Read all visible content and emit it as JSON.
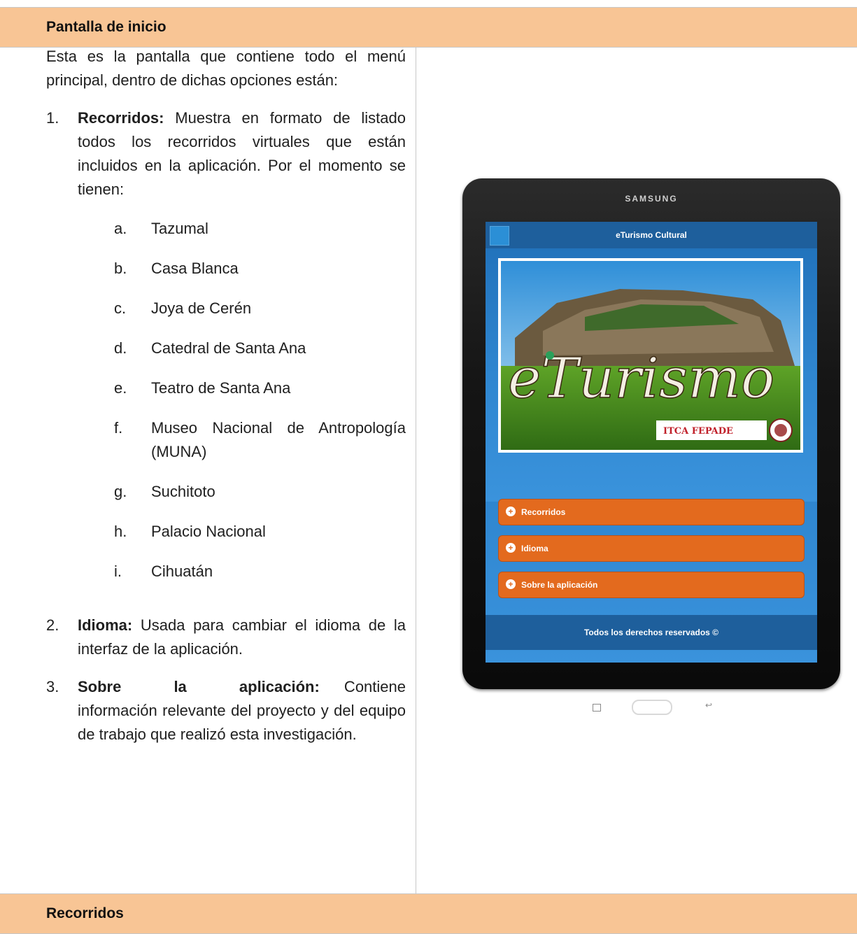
{
  "section_title": "Pantalla de inicio",
  "next_section_title": "Recorridos",
  "intro": "Esta es la pantalla que contiene todo el menú principal, dentro de dichas opciones están:",
  "items": [
    {
      "num": "1.",
      "bold": "Recorridos:",
      "text": " Muestra en formato de listado todos los recorridos virtuales que están incluidos en la aplicación. Por el momento se tienen:",
      "sub": [
        {
          "let": "a.",
          "text": "Tazumal"
        },
        {
          "let": "b.",
          "text": "Casa Blanca"
        },
        {
          "let": "c.",
          "text": "Joya de Cerén"
        },
        {
          "let": "d.",
          "text": "Catedral de Santa Ana"
        },
        {
          "let": "e.",
          "text": "Teatro de Santa Ana"
        },
        {
          "let": "f.",
          "text": "Museo Nacional de Antropología (MUNA)"
        },
        {
          "let": "g.",
          "text": "Suchitoto"
        },
        {
          "let": "h.",
          "text": "Palacio Nacional"
        },
        {
          "let": "i.",
          "text": "Cihuatán"
        }
      ]
    },
    {
      "num": "2.",
      "bold": "Idioma:",
      "text": " Usada para cambiar el idioma de la interfaz de la aplicación."
    },
    {
      "num": "3.",
      "bold": "Sobre la aplicación:",
      "text": " Contiene información relevante del proyecto y del equipo de trabajo que realizó esta investigación."
    }
  ],
  "tablet": {
    "brand": "SAMSUNG",
    "app_title": "eTurismo Cultural",
    "hero_word": "eTurismo",
    "logo_text": "ITCA FEPADE",
    "buttons": [
      "Recorridos",
      "Idioma",
      "Sobre la aplicación"
    ],
    "footer": "Todos los derechos reservados ©"
  }
}
